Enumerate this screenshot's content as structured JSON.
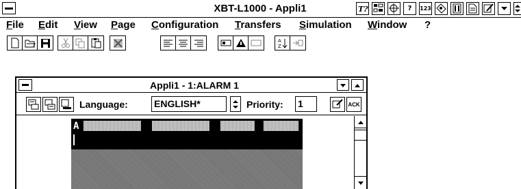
{
  "app": {
    "title": "XBT-L1000 - Appli1"
  },
  "title_icons": [
    "help-tool-icon",
    "grid-icon",
    "network-icon",
    "help-icon",
    "numbers-icon",
    "tools-icon",
    "font-icon",
    "document-icon",
    "edit-icon",
    "scroll-down-icon",
    "scroll-updown-icon"
  ],
  "title_icon_text": {
    "help": "?",
    "numbers": "123"
  },
  "menu": [
    "File",
    "Edit",
    "View",
    "Page",
    "Configuration",
    "Transfers",
    "Simulation",
    "Window",
    "?"
  ],
  "child": {
    "title": "Appli1 - 1:ALARM 1",
    "language_label": "Language:",
    "language_value": "ENGLISH*",
    "priority_label": "Priority:",
    "priority_value": "1",
    "ack_label": "ACK"
  },
  "display": {
    "first_char": "A"
  }
}
